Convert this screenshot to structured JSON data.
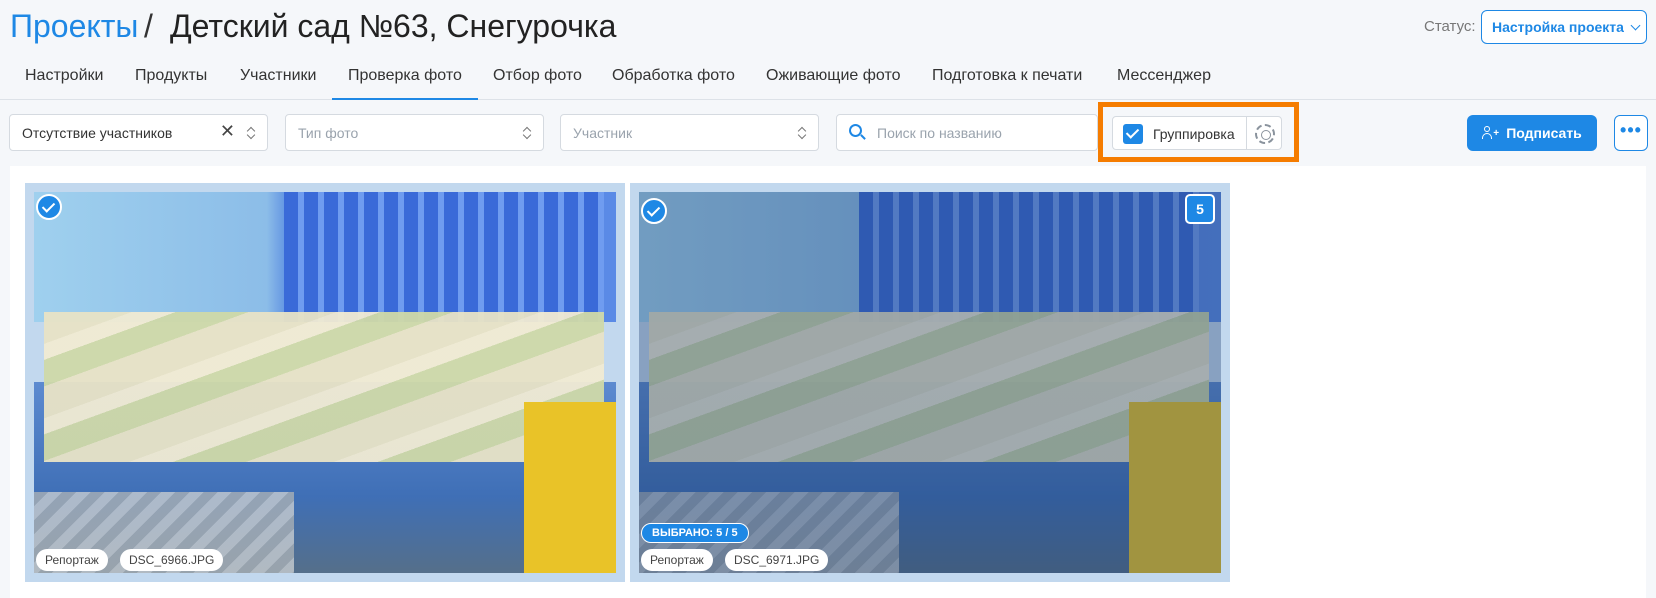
{
  "header": {
    "breadcrumb_link": "Проекты",
    "separator": "/",
    "title": "Детский сад №63, Снегурочка",
    "status_label": "Статус:",
    "status_value": "Настройка проекта"
  },
  "tabs": [
    {
      "label": "Настройки"
    },
    {
      "label": "Продукты"
    },
    {
      "label": "Участники"
    },
    {
      "label": "Проверка фото",
      "active": true
    },
    {
      "label": "Отбор фото"
    },
    {
      "label": "Обработка фото"
    },
    {
      "label": "Оживающие фото"
    },
    {
      "label": "Подготовка к печати"
    },
    {
      "label": "Мессенджер"
    }
  ],
  "filters": {
    "participants_filter": "Отсутствие участников",
    "photo_type_placeholder": "Тип фото",
    "participant_placeholder": "Участник",
    "search_placeholder": "Поиск по названию",
    "grouping_label": "Группировка",
    "grouping_checked": true
  },
  "actions": {
    "sign_label": "Подписать",
    "more_label": "•••"
  },
  "photos": [
    {
      "tag": "Репортаж",
      "filename": "DSC_6966.JPG",
      "checked": true
    },
    {
      "tag": "Репортаж",
      "filename": "DSC_6971.JPG",
      "checked": true,
      "group_count": "5",
      "selected_text": "ВЫБРАНО: 5 / 5"
    }
  ],
  "colors": {
    "accent": "#1e88e5",
    "highlight": "#f57c00"
  }
}
